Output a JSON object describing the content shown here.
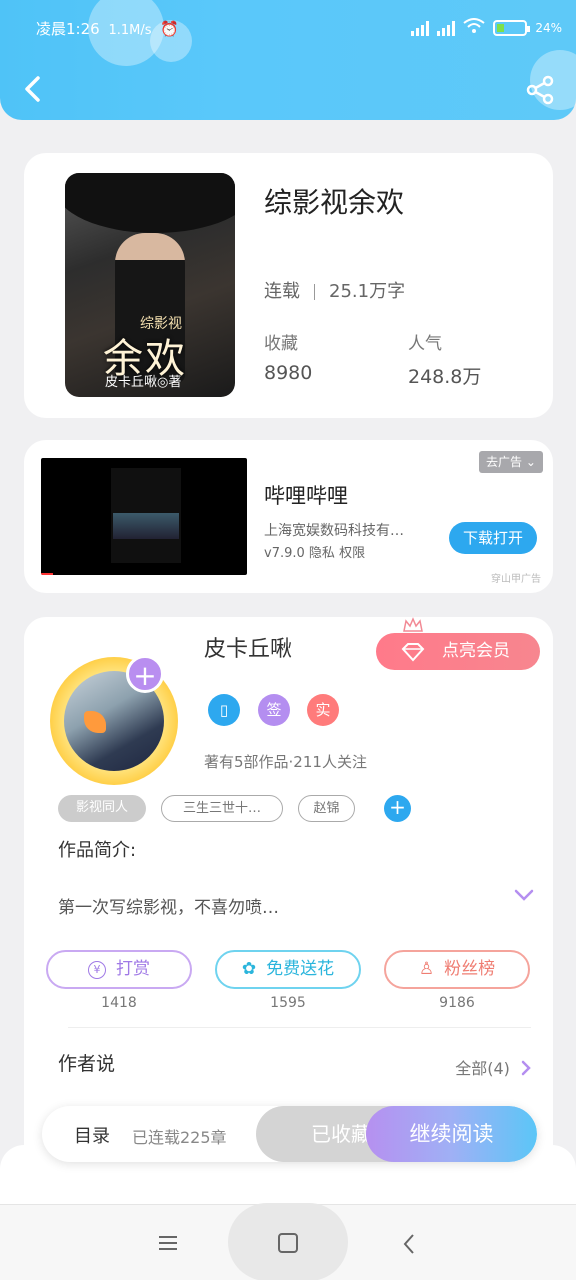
{
  "status": {
    "time": "凌晨1:26",
    "speed": "1.1M/s",
    "battery": "24%"
  },
  "book": {
    "title": "综影视余欢",
    "status": "连载",
    "word_count": "25.1万字",
    "favorites_label": "收藏",
    "favorites_value": "8980",
    "popularity_label": "人气",
    "popularity_value": "248.8万",
    "cover_small_title": "综影视",
    "cover_big_title": "余欢",
    "cover_author": "皮卡丘啾◎著"
  },
  "ad": {
    "tag": "去广告",
    "title": "哔哩哔哩",
    "company": "上海宽娱数码科技有…",
    "version": "v7.9.0",
    "privacy": "隐私",
    "permissions": "权限",
    "button": "下载打开",
    "source": "穿山甲广告"
  },
  "author": {
    "name": "皮卡丘啾",
    "vip_button": "点亮会员",
    "add_icon": "+",
    "badges": [
      {
        "label": "▯",
        "color": "#2da8ef"
      },
      {
        "label": "签",
        "color": "#b48ef0"
      },
      {
        "label": "实",
        "color": "#ff7b7b"
      }
    ],
    "works": "著有5部作品·211人关注",
    "tags": [
      "影视同人",
      "三生三世十…",
      "赵锦"
    ],
    "tag_add": "+",
    "intro_label": "作品简介:",
    "intro_text": "第一次写综影视，不喜勿喷…",
    "actions": [
      {
        "label": "打赏",
        "count": "1418",
        "color": "#b48ef0",
        "icon": "¥"
      },
      {
        "label": "免费送花",
        "count": "1595",
        "color": "#3cc4e8",
        "icon": "✿"
      },
      {
        "label": "粉丝榜",
        "count": "9186",
        "color": "#f2887f",
        "icon": "♙"
      }
    ],
    "author_says": "作者说",
    "all_link": "全部(4)"
  },
  "bottom": {
    "toc": "目录",
    "chapters": "已连载225章",
    "collected": "已收藏",
    "continue": "继续阅读"
  },
  "colors": {
    "header": "#5ac8fa",
    "accent_blue": "#2da8ef",
    "vip_pink": "#f7868f"
  }
}
